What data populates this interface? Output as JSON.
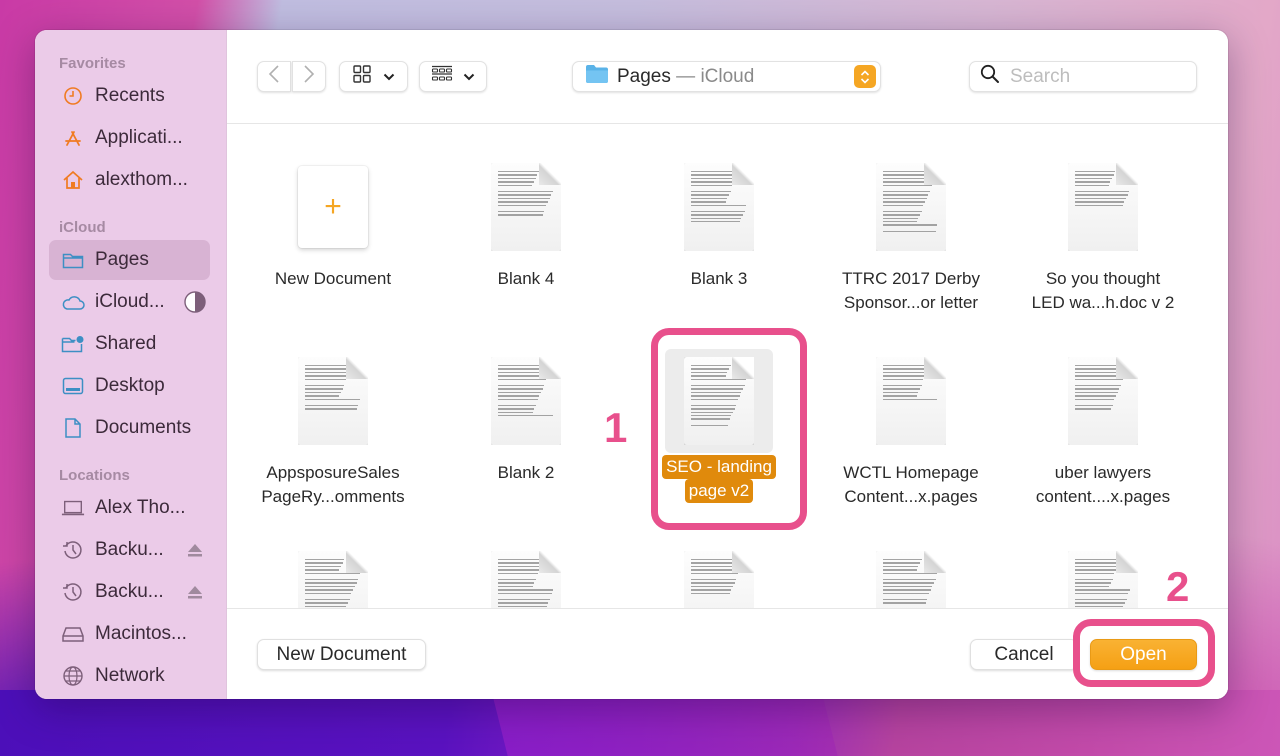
{
  "sidebar": {
    "sections": [
      {
        "title": "Favorites",
        "items": [
          {
            "label": "Recents",
            "icon": "clock-icon"
          },
          {
            "label": "Applicati...",
            "icon": "applications-icon"
          },
          {
            "label": "alexthom...",
            "icon": "home-icon"
          }
        ]
      },
      {
        "title": "iCloud",
        "items": [
          {
            "label": "Pages",
            "icon": "folder-icon",
            "selected": true
          },
          {
            "label": "iCloud...",
            "icon": "cloud-icon",
            "trailing": "storage-pie-icon"
          },
          {
            "label": "Shared",
            "icon": "shared-folder-icon"
          },
          {
            "label": "Desktop",
            "icon": "desktop-icon"
          },
          {
            "label": "Documents",
            "icon": "document-icon"
          }
        ]
      },
      {
        "title": "Locations",
        "items": [
          {
            "label": "Alex Tho...",
            "icon": "laptop-icon"
          },
          {
            "label": "Backu...",
            "icon": "time-machine-icon",
            "trailing": "eject-icon"
          },
          {
            "label": "Backu...",
            "icon": "time-machine-icon",
            "trailing": "eject-icon"
          },
          {
            "label": "Macintos...",
            "icon": "drive-icon"
          },
          {
            "label": "Network",
            "icon": "network-icon"
          }
        ]
      }
    ]
  },
  "toolbar": {
    "back_icon": "chevron-left-icon",
    "forward_icon": "chevron-right-icon",
    "view_mode_icon": "grid-view-icon",
    "group_mode_icon": "group-view-icon",
    "location": {
      "name": "Pages",
      "separator": " — ",
      "source": "iCloud"
    },
    "search_placeholder": "Search",
    "search_value": ""
  },
  "files": [
    {
      "name_lines": [
        "New Document"
      ],
      "type": "new"
    },
    {
      "name_lines": [
        "Blank 4"
      ],
      "type": "doc"
    },
    {
      "name_lines": [
        "Blank 3"
      ],
      "type": "doc"
    },
    {
      "name_lines": [
        "TTRC 2017 Derby",
        "Sponsor...or letter"
      ],
      "type": "doc"
    },
    {
      "name_lines": [
        "So you thought",
        "LED wa...h.doc v 2"
      ],
      "type": "doc"
    },
    {
      "name_lines": [
        "AppsposureSales",
        "PageRy...omments"
      ],
      "type": "doc"
    },
    {
      "name_lines": [
        "Blank 2"
      ],
      "type": "doc"
    },
    {
      "name_lines": [
        "SEO - landing",
        "page v2"
      ],
      "type": "doc",
      "selected": true
    },
    {
      "name_lines": [
        "WCTL Homepage",
        "Content...x.pages"
      ],
      "type": "doc"
    },
    {
      "name_lines": [
        "uber lawyers",
        "content....x.pages"
      ],
      "type": "doc"
    },
    {
      "name_lines": [
        ""
      ],
      "type": "doc"
    },
    {
      "name_lines": [
        ""
      ],
      "type": "doc"
    },
    {
      "name_lines": [
        ""
      ],
      "type": "doc"
    },
    {
      "name_lines": [
        ""
      ],
      "type": "doc"
    },
    {
      "name_lines": [
        ""
      ],
      "type": "doc"
    }
  ],
  "footer": {
    "new_document_label": "New Document",
    "cancel_label": "Cancel",
    "open_label": "Open"
  },
  "annotations": [
    {
      "label": "1",
      "target": "selected-file"
    },
    {
      "label": "2",
      "target": "open-button"
    }
  ],
  "colors": {
    "accent": "#f5a623",
    "selection": "#e08a0c",
    "annotation": "#e8508c",
    "sidebar_bg": "#ebcbe8",
    "sidebar_icon_blue": "#3d8fc4",
    "sidebar_icon_orange": "#f07b22"
  }
}
